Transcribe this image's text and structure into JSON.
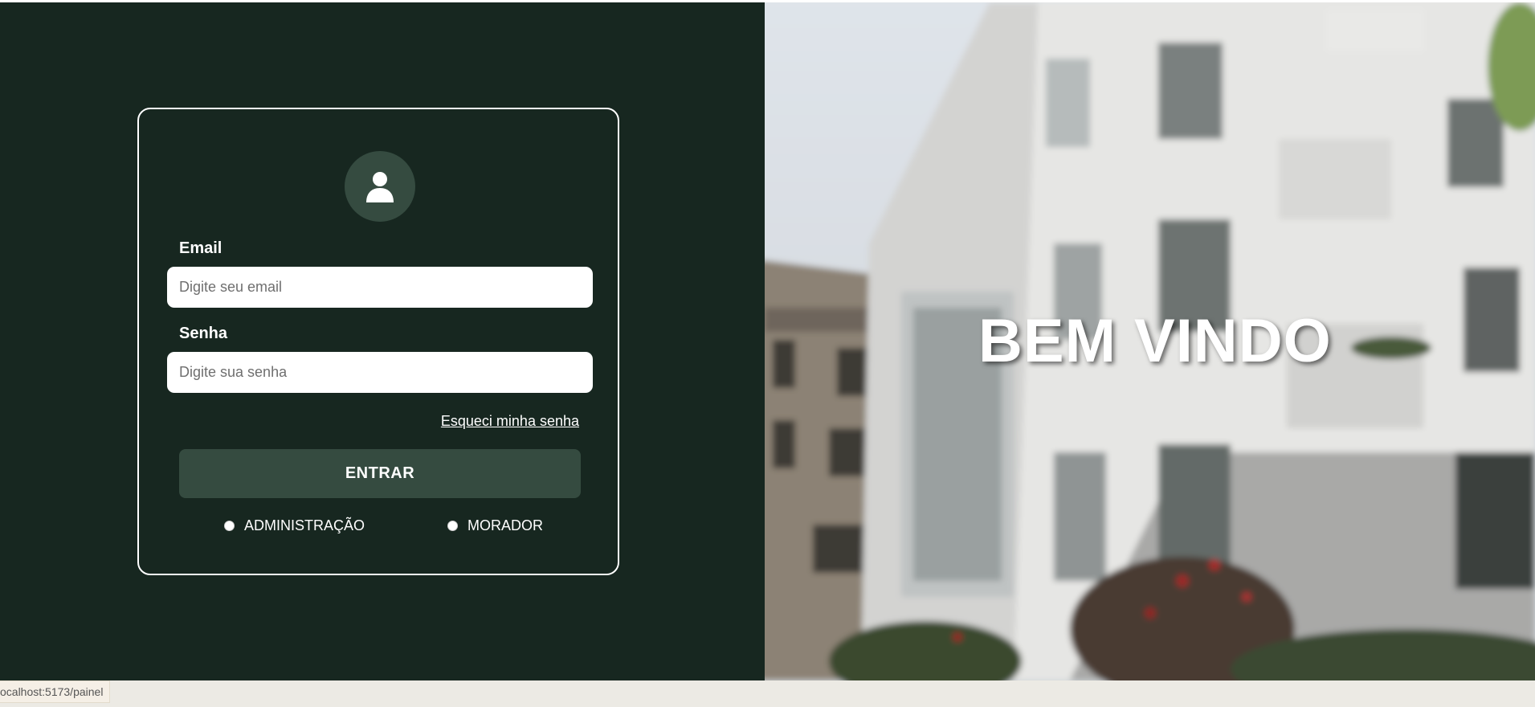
{
  "login": {
    "email_label": "Email",
    "email_placeholder": "Digite seu email",
    "password_label": "Senha",
    "password_placeholder": "Digite sua senha",
    "forgot_link": "Esqueci minha senha",
    "enter_button": "ENTRAR",
    "roles": [
      {
        "label": "ADMINISTRAÇÃO"
      },
      {
        "label": "MORADOR"
      }
    ]
  },
  "hero": {
    "welcome_text": "BEM VINDO"
  },
  "status_bar": {
    "url": "ocalhost:5173/painel"
  },
  "colors": {
    "left_panel_bg": "#172720",
    "accent": "#354b40",
    "white": "#ffffff"
  },
  "icons": {
    "avatar": "user-icon"
  }
}
